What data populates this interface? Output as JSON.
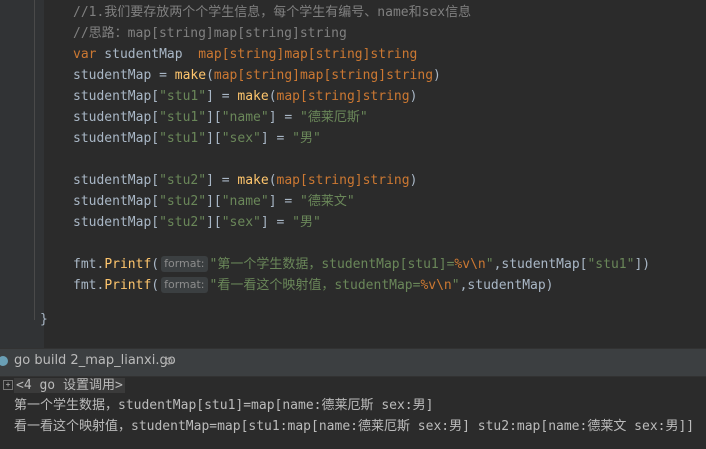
{
  "editor": {
    "lines": {
      "l1_comment": "//1.我们要存放两个个学生信息，每个学生有编号、name和sex信息",
      "l2_comment": "//思路：map[string]map[string]string",
      "l3_var": "var",
      "l3_name": " studentMap  ",
      "l3_type": "map[string]map[string]string",
      "l4_lhs": "studentMap = ",
      "l4_make": "make",
      "l4_args_type": "map[string]map[string]string",
      "l5_lhs": "studentMap[",
      "l5_key": "\"stu1\"",
      "l5_mid": "] = ",
      "l5_make": "make",
      "l5_type": "map[string]string",
      "l6_lhs": "studentMap[",
      "l6_key1": "\"stu1\"",
      "l6_key2": "\"name\"",
      "l6_val": "\"德莱厄斯\"",
      "l7_lhs": "studentMap[",
      "l7_key1": "\"stu1\"",
      "l7_key2": "\"sex\"",
      "l7_val": "\"男\"",
      "l8_lhs": "studentMap[",
      "l8_key": "\"stu2\"",
      "l8_mid": "] = ",
      "l8_make": "make",
      "l8_type": "map[string]string",
      "l9_key1": "\"stu2\"",
      "l9_key2": "\"name\"",
      "l9_val": "\"德莱文\"",
      "l10_key1": "\"stu2\"",
      "l10_key2": "\"sex\"",
      "l10_val": "\"男\"",
      "l11_pkg": "fmt.",
      "l11_fn": "Printf",
      "l11_hint": "format:",
      "l11_str": "\"第一个学生数据，studentMap[stu1]=",
      "l11_esc": "%v\\n",
      "l11_str_end": "\"",
      "l11_rest": ",studentMap[",
      "l11_key": "\"stu1\"",
      "l11_close": "])",
      "l12_pkg": "fmt.",
      "l12_fn": "Printf",
      "l12_hint": "format:",
      "l12_str": "\"看一看这个映射值，studentMap=",
      "l12_esc": "%v\\n",
      "l12_str_end": "\"",
      "l12_rest": ",studentMap)"
    },
    "closing_brace": "}"
  },
  "run": {
    "title": "go build 2_map_lianxi.go",
    "settings_icon": "gear-icon",
    "folded": "<4 go 设置调用>",
    "output": [
      "第一个学生数据，studentMap[stu1]=map[name:德莱厄斯 sex:男]",
      "看一看这个映射值，studentMap=map[stu1:map[name:德莱厄斯 sex:男] stu2:map[name:德莱文 sex:男]]"
    ]
  }
}
